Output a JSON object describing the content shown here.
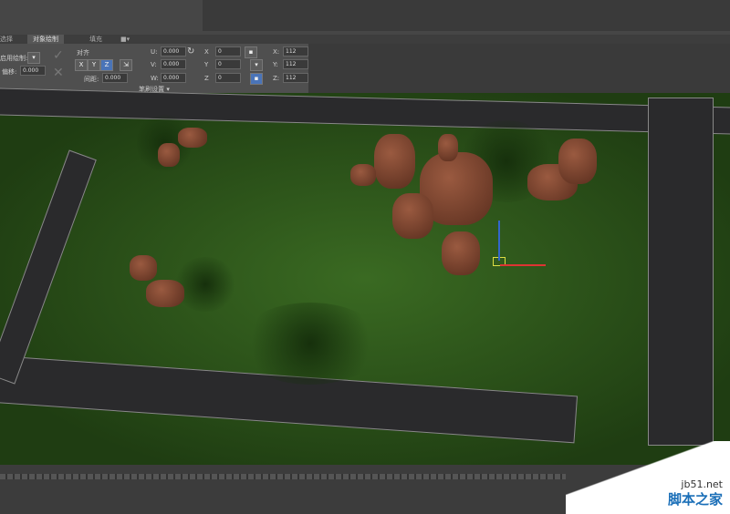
{
  "tabs": [
    "选择",
    "对象绘制",
    "填充"
  ],
  "ribbon": {
    "paint_on_label": "启用绘制:",
    "offset_label": "偏移:",
    "offset_value": "0.000",
    "align_label": "对齐",
    "axes": [
      "X",
      "Y",
      "Z"
    ],
    "active_axis": "Z",
    "spacing_label": "间距:",
    "spacing_value": "0.000",
    "uvw": [
      {
        "label": "U:",
        "value": "0.000"
      },
      {
        "label": "V:",
        "value": "0.000"
      },
      {
        "label": "W:",
        "value": "0.000"
      }
    ],
    "rotation": [
      {
        "label": "X",
        "value": "0"
      },
      {
        "label": "Y",
        "value": "0"
      },
      {
        "label": "Z",
        "value": "0"
      }
    ],
    "scale": [
      {
        "label": "X:",
        "value": "112"
      },
      {
        "label": "Y:",
        "value": "112"
      },
      {
        "label": "Z:",
        "value": "112"
      }
    ],
    "footer": "笔刷设置 ▾"
  },
  "watermark": {
    "site": "jb51.net",
    "name": "脚本之家"
  }
}
